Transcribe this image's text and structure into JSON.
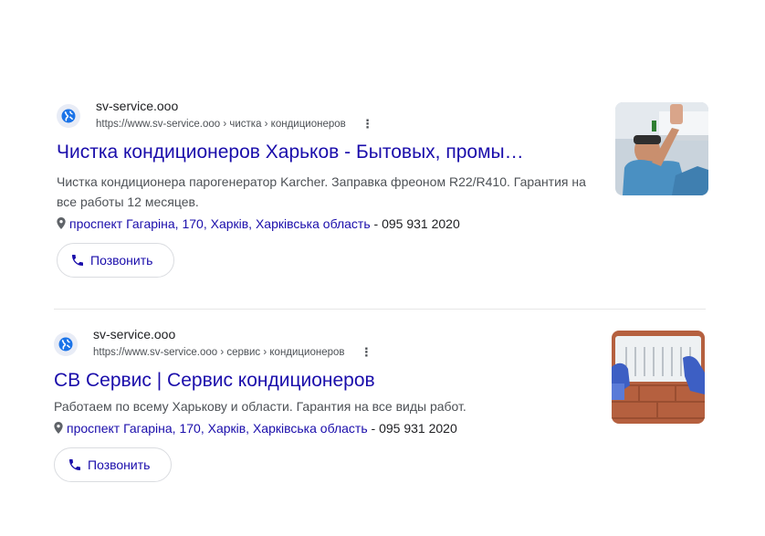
{
  "results": [
    {
      "site_name": "sv-service.ooo",
      "url_breadcrumb": "https://www.sv-service.ooo › чистка › кондиционеров",
      "title": "Чистка кондиционеров Харьков - Бытовых, промы…",
      "snippet": "Чистка кондиционера парогенератор Karcher. Заправка фреоном R22/R410. Гарантия на все работы 12 месяцев.",
      "address": "проспект Гагаріна, 170, Харків, Харківська область",
      "phone_sep": " - ",
      "phone": "095 931 2020",
      "call_label": "Позвонить",
      "thumbnail_icon": "technician-installing-ac-photo"
    },
    {
      "site_name": "sv-service.ooo",
      "url_breadcrumb": "https://www.sv-service.ooo › сервис › кондиционеров",
      "title": "СВ Сервис | Сервис кондиционеров",
      "snippet": "Работаем по всему Харькову и области. Гарантия на все виды работ.",
      "address": "проспект Гагаріна, 170, Харків, Харківська область",
      "phone_sep": " - ",
      "phone": "095 931 2020",
      "call_label": "Позвонить",
      "thumbnail_icon": "gloved-hands-cleaning-ac-photo"
    }
  ],
  "colors": {
    "link": "#1a0dab",
    "text": "#202124",
    "muted": "#4d5156",
    "favicon_globe": "#1a73e8"
  }
}
